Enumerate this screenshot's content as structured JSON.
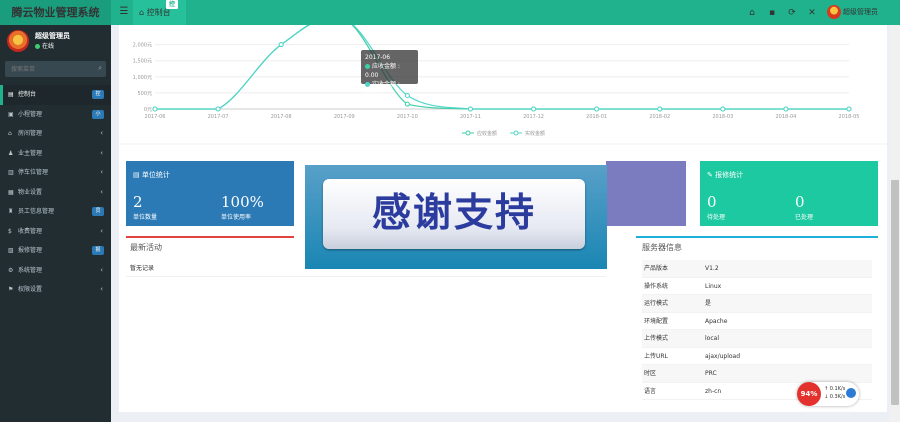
{
  "colors": {
    "topbar": "#1fb28c",
    "sidebar": "#222d32",
    "series1": "#3fcfa6",
    "series2": "#52d5c8",
    "blue_box": "#2b79b5",
    "green_box": "#1cc9a0",
    "purple_box": "#7b7cbf",
    "activity_border": "#e0443b",
    "server_border": "#1fb0d9"
  },
  "header": {
    "brand": "腾云物业管理系统",
    "menu_icon": "☰",
    "tab_label": "控制台",
    "tab_badge": "控",
    "icons": [
      "home-icon",
      "trash-icon",
      "refresh-icon",
      "fullscreen-icon"
    ],
    "icon_glyphs": [
      "⌂",
      "▪",
      "⟳",
      "✕"
    ],
    "user_name": "超级管理员"
  },
  "sidebar": {
    "user_name": "超级管理员",
    "status": "在线",
    "search_placeholder": "搜索菜单",
    "items": [
      {
        "label": "控制台",
        "icon": "▤",
        "badge": "控",
        "badge_color": "#2b79b5"
      },
      {
        "label": "小程管理",
        "icon": "▣",
        "badge": "小",
        "badge_color": "#2b79b5"
      },
      {
        "label": "房间管理",
        "icon": "⌂",
        "chevron": "‹"
      },
      {
        "label": "业主管理",
        "icon": "♟",
        "chevron": "‹"
      },
      {
        "label": "停车位管理",
        "icon": "▥",
        "chevron": "‹"
      },
      {
        "label": "物业设置",
        "icon": "▦",
        "chevron": "‹"
      },
      {
        "label": "员工信息管理",
        "icon": "♜",
        "badge": "员",
        "badge_color": "#2b79b5"
      },
      {
        "label": "收费管理",
        "icon": "$",
        "chevron": "‹"
      },
      {
        "label": "报修管理",
        "icon": "▧",
        "badge": "报",
        "badge_color": "#2b79b5"
      },
      {
        "label": "系统管理",
        "icon": "⚙",
        "chevron": "‹"
      },
      {
        "label": "权限设置",
        "icon": "⚑",
        "chevron": "‹"
      }
    ]
  },
  "chart_data": {
    "type": "line",
    "x": [
      "2017-06",
      "2017-07",
      "2017-08",
      "2017-09",
      "2017-10",
      "2017-11",
      "2017-12",
      "2018-01",
      "2018-02",
      "2018-03",
      "2018-04",
      "2018-05"
    ],
    "yticks": [
      "0元",
      "500元",
      "1,000元",
      "1,500元",
      "2,000元"
    ],
    "ylim": [
      0,
      2300
    ],
    "series": [
      {
        "name": "应收金额",
        "values": [
          0,
          0,
          2000,
          2800,
          150,
          0,
          0,
          0,
          0,
          0,
          0,
          0
        ]
      },
      {
        "name": "实收金额",
        "values": [
          0,
          0,
          2000,
          2800,
          420,
          0,
          0,
          0,
          0,
          0,
          0,
          0
        ]
      }
    ],
    "tooltip": {
      "title": "2017-06",
      "rows": [
        "应收金额 : 0.00",
        "实收金额 : 0.00"
      ]
    }
  },
  "boxes": {
    "unit": {
      "title": "单位统计",
      "icon": "▤",
      "v1": "2",
      "l1": "单位数量",
      "v2": "100%",
      "l2": "单位使用率"
    },
    "repair": {
      "title": "报修统计",
      "icon": "✎",
      "v1": "0",
      "l1": "待处理",
      "v2": "0",
      "l2": "已处理"
    }
  },
  "banner": {
    "text": "感谢支持"
  },
  "activity": {
    "title": "最新活动",
    "body": "暂无记录"
  },
  "server": {
    "title": "服务器信息",
    "rows": [
      {
        "k": "产品版本",
        "v": "V1.2"
      },
      {
        "k": "操作系统",
        "v": "Linux"
      },
      {
        "k": "运行模式",
        "v": "是"
      },
      {
        "k": "环境配置",
        "v": "Apache"
      },
      {
        "k": "上传模式",
        "v": "local"
      },
      {
        "k": "上传URL",
        "v": "ajax/upload"
      },
      {
        "k": "时区",
        "v": "PRC"
      },
      {
        "k": "语言",
        "v": "zh-cn"
      }
    ]
  },
  "speed": {
    "percent": "94%",
    "up": "0.1K/s",
    "down": "0.3K/s"
  }
}
